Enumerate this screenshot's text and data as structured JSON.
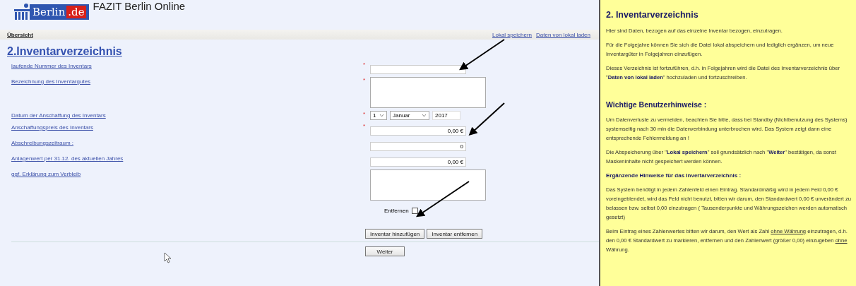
{
  "header": {
    "logo": {
      "name": "Berlin",
      "suffix": ".de"
    },
    "title": "FAZIT Berlin Online"
  },
  "nav": {
    "left": "Übersicht",
    "links": [
      "Lokal speichern",
      "Daten von lokal laden"
    ]
  },
  "form": {
    "heading": "2.Inventarverzeichnis",
    "required_mark": "*",
    "fields": [
      {
        "label": "laufende Nummer des Inventars",
        "kind": "text",
        "required": true
      },
      {
        "label": "Bezeichnung des Inventargutes",
        "kind": "textarea",
        "required": true
      },
      {
        "label": "Datum der Anschaffung des Inventars",
        "kind": "date",
        "required": true,
        "day": "1",
        "month": "Januar",
        "year": "2017"
      },
      {
        "label": "Anschaffungspreis des Inventars",
        "kind": "text",
        "required": true,
        "value": "0,00 €"
      },
      {
        "label": "Abschreibungszeitraum :",
        "kind": "text",
        "required": false,
        "value": "0"
      },
      {
        "label": "Anlagenwert per 31.12. des aktuellen Jahres",
        "kind": "text",
        "required": false,
        "value": "0,00 €"
      },
      {
        "label": "ggf. Erklärung zum Verbleib",
        "kind": "textarea",
        "required": false
      }
    ],
    "remove": {
      "label": "Entfernen",
      "checked": false
    },
    "buttons": [
      "Inventar hinzufügen",
      "Inventar entfernen"
    ],
    "next": "Weiter"
  },
  "help": {
    "heading": "2. Inventarverzeichnis",
    "blocks": [
      {
        "kind": "paragraph",
        "parts": [
          {
            "text": "Hier sind Daten, bezogen auf das einzelne Inventar bezogen, einzutragen.",
            "link": false
          }
        ]
      },
      {
        "kind": "paragraph",
        "parts": [
          {
            "text": "Für die Folgejahre können Sie sich die Datei lokal abspeichern und lediglich ergänzen, um neue Inventargüter in Folgejahren einzufügen.",
            "link": false
          }
        ]
      },
      {
        "kind": "paragraph",
        "parts": [
          {
            "text": "Dieses Verzeichnis ist fortzuführen, d.h. in Folgejahren wird die Datei des Inventarverzeichnis über \"**Daten von lokal laden**\" hochzuladen und fortzuschreiben.",
            "link": false
          }
        ]
      },
      {
        "kind": "heading",
        "parts": [
          {
            "text": "Wichtige Benutzerhinweise :",
            "link": false
          }
        ]
      },
      {
        "kind": "paragraph",
        "parts": [
          {
            "text": "Um Datenverluste zu vermeiden, beachten Sie bitte, dass bei Standby (Nichtbenutzung des Systems) systemseitig nach 30 min die Datenverbindung unterbrochen wird. Das System zeigt dann eine entsprechende Fehlermeldung an !",
            "link": false
          }
        ]
      },
      {
        "kind": "paragraph",
        "parts": [
          {
            "text": "Die Abspeicherung über \"**Lokal speichern**\" soll grundsätzlich nach \"**Weiter**\" bestätigen, da sonst Maskeninhalte nicht gespeichert werden können.",
            "link": false
          }
        ]
      },
      {
        "kind": "subheading",
        "parts": [
          {
            "text": "Ergänzende Hinweise für das Invertarverzeichnis :",
            "link": false
          }
        ]
      },
      {
        "kind": "paragraph",
        "parts": [
          {
            "text": "Das System benötigt in jedem Zahlenfeld einen Eintrag. Standardmäßig wird in jedem Feld 0,00 € voreingeblendet, wird das Feld nicht benutzt, bitten wir darum, den Standardwert 0,00 € unverändert zu belassen bzw. selbst 0,00 einzutragen ( Tausenderpunkte und Währungszeichen werden automatisch gesetzt)",
            "link": false
          }
        ]
      },
      {
        "kind": "paragraph",
        "parts": [
          {
            "text": "Beim Eintrag eines Zahlenwertes bitten wir darum, den Wert als Zahl ",
            "link": false
          },
          {
            "text": "ohne Währung",
            "link": true
          },
          {
            "text": " einzutragen, d.h. den 0,00 € Standardwert zu markieren, entfernen und den Zahlenwert (größer 0,00) einzugeben ",
            "link": false
          },
          {
            "text": "ohne",
            "link": true
          },
          {
            "text": " Währung.",
            "link": false
          }
        ]
      }
    ]
  }
}
